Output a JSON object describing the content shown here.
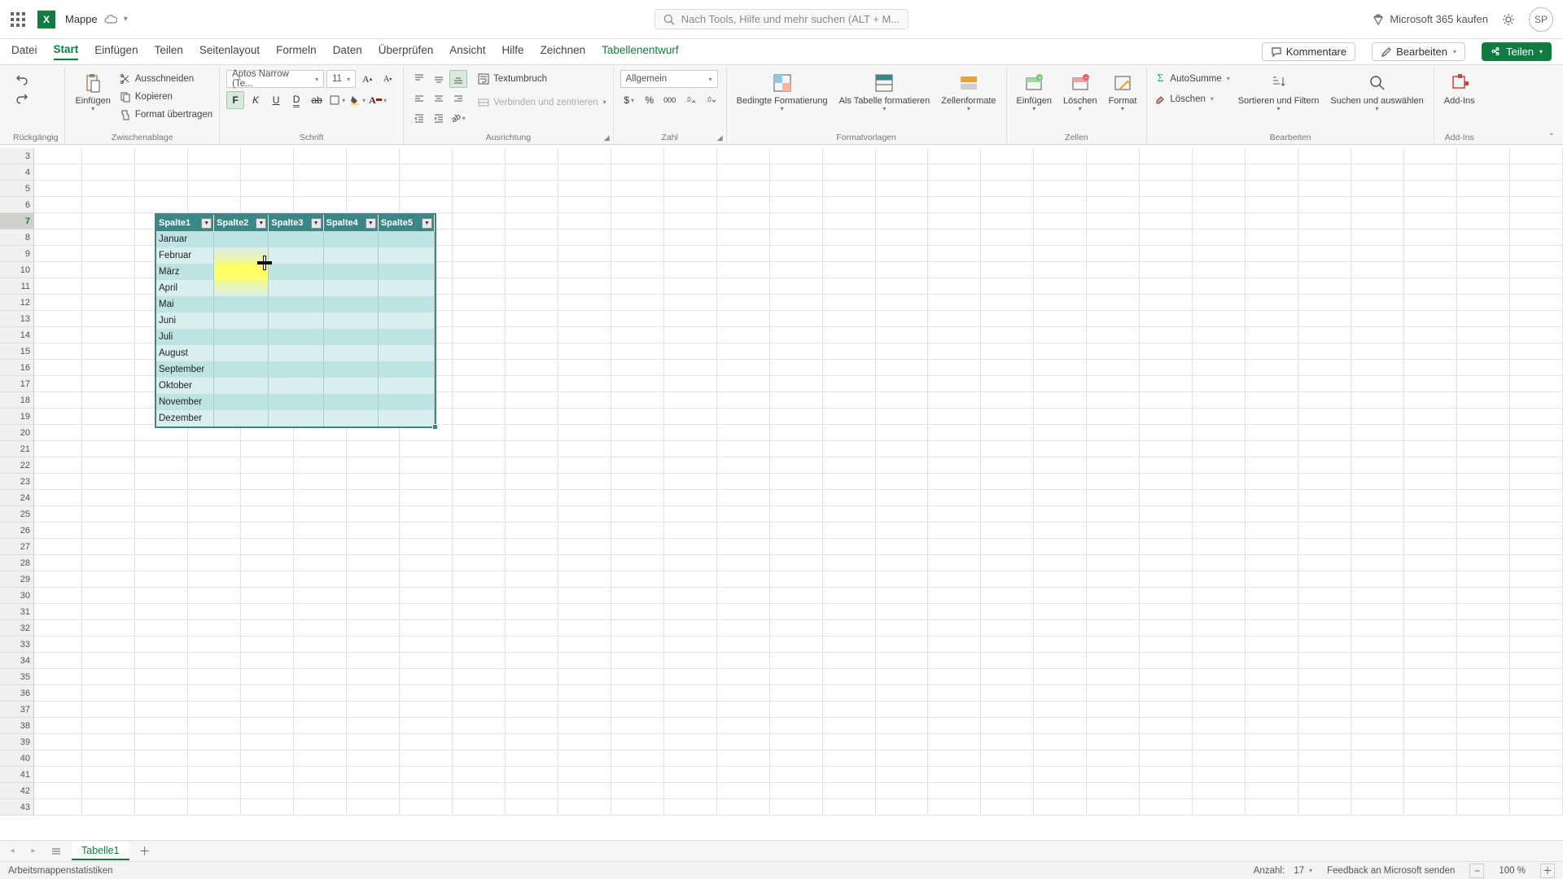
{
  "title": {
    "doc_name": "Mappe"
  },
  "search": {
    "placeholder": "Nach Tools, Hilfe und mehr suchen (ALT + M..."
  },
  "header": {
    "buy": "Microsoft 365 kaufen",
    "avatar": "SP"
  },
  "menu": {
    "tabs": [
      "Datei",
      "Start",
      "Einfügen",
      "Teilen",
      "Seitenlayout",
      "Formeln",
      "Daten",
      "Überprüfen",
      "Ansicht",
      "Hilfe",
      "Zeichnen",
      "Tabellenentwurf"
    ],
    "comments": "Kommentare",
    "edit": "Bearbeiten",
    "share": "Teilen"
  },
  "ribbon": {
    "undo_group": "Rückgängig",
    "clipboard": {
      "paste": "Einfügen",
      "cut": "Ausschneiden",
      "copy": "Kopieren",
      "format_painter": "Format übertragen",
      "label": "Zwischenablage"
    },
    "font": {
      "name": "Aptos Narrow (Te...",
      "size": "11",
      "label": "Schrift",
      "bold": "F",
      "italic": "K",
      "underline": "U"
    },
    "align": {
      "wrap": "Textumbruch",
      "merge": "Verbinden und zentrieren",
      "label": "Ausrichtung"
    },
    "number": {
      "format": "Allgemein",
      "label": "Zahl"
    },
    "styles": {
      "cond": "Bedingte Formatierung",
      "astable": "Als Tabelle formatieren",
      "cellfmt": "Zellenformate",
      "label": "Formatvorlagen"
    },
    "cells": {
      "insert": "Einfügen",
      "delete": "Löschen",
      "format": "Format",
      "label": "Zellen"
    },
    "editing": {
      "autosum": "AutoSumme",
      "clear": "Löschen",
      "sortfilter": "Sortieren und Filtern",
      "findselect": "Suchen und auswählen",
      "label": "Bearbeiten"
    },
    "addins": {
      "btn": "Add-Ins",
      "label": "Add-Ins"
    }
  },
  "table": {
    "headers": [
      "Spalte1",
      "Spalte2",
      "Spalte3",
      "Spalte4",
      "Spalte5"
    ],
    "rows": [
      "Januar",
      "Februar",
      "März",
      "April",
      "Mai",
      "Juni",
      "Juli",
      "August",
      "September",
      "Oktober",
      "November",
      "Dezember"
    ]
  },
  "row_start": 3,
  "row_end": 43,
  "sheets": {
    "tab1": "Tabelle1"
  },
  "status": {
    "stats": "Arbeitsmappenstatistiken",
    "count_label": "Anzahl:",
    "count_value": "17",
    "feedback": "Feedback an Microsoft senden",
    "zoom": "100 %"
  },
  "chart_data": {
    "type": "table",
    "columns": [
      "Spalte1",
      "Spalte2",
      "Spalte3",
      "Spalte4",
      "Spalte5"
    ],
    "rows": [
      [
        "Januar",
        "",
        "",
        "",
        ""
      ],
      [
        "Februar",
        "",
        "",
        "",
        ""
      ],
      [
        "März",
        "",
        "",
        "",
        ""
      ],
      [
        "April",
        "",
        "",
        "",
        ""
      ],
      [
        "Mai",
        "",
        "",
        "",
        ""
      ],
      [
        "Juni",
        "",
        "",
        "",
        ""
      ],
      [
        "Juli",
        "",
        "",
        "",
        ""
      ],
      [
        "August",
        "",
        "",
        "",
        ""
      ],
      [
        "September",
        "",
        "",
        "",
        ""
      ],
      [
        "Oktober",
        "",
        "",
        "",
        ""
      ],
      [
        "November",
        "",
        "",
        "",
        ""
      ],
      [
        "Dezember",
        "",
        "",
        "",
        ""
      ]
    ]
  }
}
